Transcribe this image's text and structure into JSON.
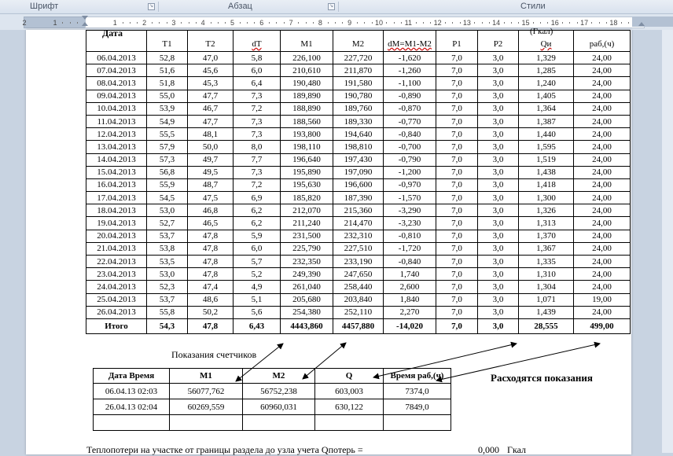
{
  "ribbon": {
    "groups": [
      "Шрифт",
      "Абзац",
      "Стили"
    ]
  },
  "ruler": {
    "numbers": [
      "2",
      "1",
      "1",
      "2",
      "3",
      "4",
      "5",
      "6",
      "7",
      "8",
      "9",
      "10",
      "11",
      "12",
      "13",
      "14",
      "15",
      "16",
      "17",
      "18"
    ]
  },
  "main_table": {
    "top_partial": [
      "Дата",
      "(Гкал)"
    ],
    "headers": [
      "",
      "T1",
      "T2",
      "dT",
      "M1",
      "M2",
      "dM=M1-M2",
      "P1",
      "P2",
      "Qи",
      "раб,(ч)"
    ],
    "rows": [
      [
        "06.04.2013",
        "52,8",
        "47,0",
        "5,8",
        "226,100",
        "227,720",
        "-1,620",
        "7,0",
        "3,0",
        "1,329",
        "24,00"
      ],
      [
        "07.04.2013",
        "51,6",
        "45,6",
        "6,0",
        "210,610",
        "211,870",
        "-1,260",
        "7,0",
        "3,0",
        "1,285",
        "24,00"
      ],
      [
        "08.04.2013",
        "51,8",
        "45,3",
        "6,4",
        "190,480",
        "191,580",
        "-1,100",
        "7,0",
        "3,0",
        "1,240",
        "24,00"
      ],
      [
        "09.04.2013",
        "55,0",
        "47,7",
        "7,3",
        "189,890",
        "190,780",
        "-0,890",
        "7,0",
        "3,0",
        "1,405",
        "24,00"
      ],
      [
        "10.04.2013",
        "53,9",
        "46,7",
        "7,2",
        "188,890",
        "189,760",
        "-0,870",
        "7,0",
        "3,0",
        "1,364",
        "24,00"
      ],
      [
        "11.04.2013",
        "54,9",
        "47,7",
        "7,3",
        "188,560",
        "189,330",
        "-0,770",
        "7,0",
        "3,0",
        "1,387",
        "24,00"
      ],
      [
        "12.04.2013",
        "55,5",
        "48,1",
        "7,3",
        "193,800",
        "194,640",
        "-0,840",
        "7,0",
        "3,0",
        "1,440",
        "24,00"
      ],
      [
        "13.04.2013",
        "57,9",
        "50,0",
        "8,0",
        "198,110",
        "198,810",
        "-0,700",
        "7,0",
        "3,0",
        "1,595",
        "24,00"
      ],
      [
        "14.04.2013",
        "57,3",
        "49,7",
        "7,7",
        "196,640",
        "197,430",
        "-0,790",
        "7,0",
        "3,0",
        "1,519",
        "24,00"
      ],
      [
        "15.04.2013",
        "56,8",
        "49,5",
        "7,3",
        "195,890",
        "197,090",
        "-1,200",
        "7,0",
        "3,0",
        "1,438",
        "24,00"
      ],
      [
        "16.04.2013",
        "55,9",
        "48,7",
        "7,2",
        "195,630",
        "196,600",
        "-0,970",
        "7,0",
        "3,0",
        "1,418",
        "24,00"
      ],
      [
        "17.04.2013",
        "54,5",
        "47,5",
        "6,9",
        "185,820",
        "187,390",
        "-1,570",
        "7,0",
        "3,0",
        "1,300",
        "24,00"
      ],
      [
        "18.04.2013",
        "53,0",
        "46,8",
        "6,2",
        "212,070",
        "215,360",
        "-3,290",
        "7,0",
        "3,0",
        "1,326",
        "24,00"
      ],
      [
        "19.04.2013",
        "52,7",
        "46,5",
        "6,2",
        "211,240",
        "214,470",
        "-3,230",
        "7,0",
        "3,0",
        "1,313",
        "24,00"
      ],
      [
        "20.04.2013",
        "53,7",
        "47,8",
        "5,9",
        "231,500",
        "232,310",
        "-0,810",
        "7,0",
        "3,0",
        "1,370",
        "24,00"
      ],
      [
        "21.04.2013",
        "53,8",
        "47,8",
        "6,0",
        "225,790",
        "227,510",
        "-1,720",
        "7,0",
        "3,0",
        "1,367",
        "24,00"
      ],
      [
        "22.04.2013",
        "53,5",
        "47,8",
        "5,7",
        "232,350",
        "233,190",
        "-0,840",
        "7,0",
        "3,0",
        "1,335",
        "24,00"
      ],
      [
        "23.04.2013",
        "53,0",
        "47,8",
        "5,2",
        "249,390",
        "247,650",
        "1,740",
        "7,0",
        "3,0",
        "1,310",
        "24,00"
      ],
      [
        "24.04.2013",
        "52,3",
        "47,4",
        "4,9",
        "261,040",
        "258,440",
        "2,600",
        "7,0",
        "3,0",
        "1,304",
        "24,00"
      ],
      [
        "25.04.2013",
        "53,7",
        "48,6",
        "5,1",
        "205,680",
        "203,840",
        "1,840",
        "7,0",
        "3,0",
        "1,071",
        "19,00"
      ],
      [
        "26.04.2013",
        "55,8",
        "50,2",
        "5,6",
        "254,380",
        "252,110",
        "2,270",
        "7,0",
        "3,0",
        "1,439",
        "24,00"
      ]
    ],
    "total": [
      "Итого",
      "54,3",
      "47,8",
      "6,43",
      "4443,860",
      "4457,880",
      "-14,020",
      "7,0",
      "3,0",
      "28,555",
      "499,00"
    ]
  },
  "meters": {
    "caption": "Показания счетчиков",
    "headers": [
      "Дата Время",
      "M1",
      "M2",
      "Q",
      "Время раб,(ч)"
    ],
    "rows": [
      [
        "06.04.13 02:03",
        "56077,762",
        "56752,238",
        "603,003",
        "7374,0"
      ],
      [
        "26.04.13 02:04",
        "60269,559",
        "60960,031",
        "630,122",
        "7849,0"
      ],
      [
        "",
        "",
        "",
        "",
        ""
      ]
    ]
  },
  "note": "Расходятся показания",
  "bottom_line": {
    "text": "Теплопотери на участке от границы раздела до узла учета    Qпотерь =",
    "value": "0,000",
    "unit": "Гкал"
  }
}
